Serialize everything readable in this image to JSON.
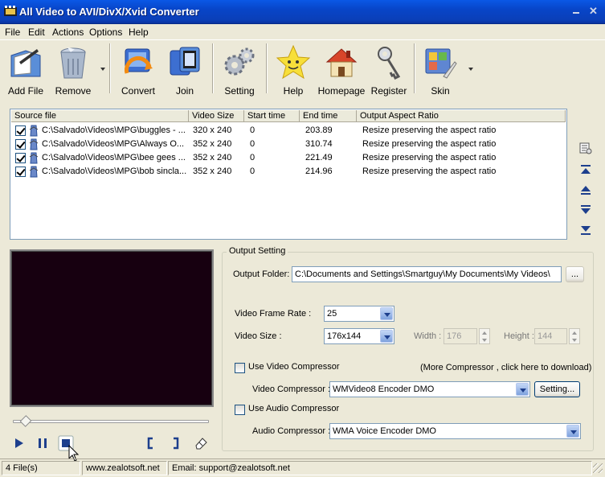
{
  "window": {
    "title": "All Video to AVI/DivX/Xvid Converter"
  },
  "menu": [
    {
      "label": "File"
    },
    {
      "label": "Edit"
    },
    {
      "label": "Actions"
    },
    {
      "label": "Options"
    },
    {
      "label": "Help"
    }
  ],
  "toolbar": [
    {
      "label": "Add File",
      "icon": "add-file-icon"
    },
    {
      "label": "Remove",
      "icon": "recycle-bin-icon"
    },
    {
      "label": "Convert",
      "icon": "convert-icon"
    },
    {
      "label": "Join",
      "icon": "join-icon"
    },
    {
      "label": "Setting",
      "icon": "gears-icon"
    },
    {
      "label": "Help",
      "icon": "star-help-icon"
    },
    {
      "label": "Homepage",
      "icon": "house-icon"
    },
    {
      "label": "Register",
      "icon": "keys-icon"
    },
    {
      "label": "Skin",
      "icon": "skin-icon"
    }
  ],
  "file_list": {
    "columns": [
      "Source file",
      "Video Size",
      "Start time",
      "End time",
      "Output Aspect Ratio"
    ],
    "rows": [
      {
        "source": "C:\\Salvado\\Videos\\MPG\\buggles - ...",
        "size": "320 x 240",
        "start": "0",
        "end": "203.89",
        "aspect": "Resize preserving the aspect ratio",
        "checked": true,
        "selected": true
      },
      {
        "source": "C:\\Salvado\\Videos\\MPG\\Always O...",
        "size": "352 x 240",
        "start": "0",
        "end": "310.74",
        "aspect": "Resize preserving the aspect ratio",
        "checked": true,
        "selected": false
      },
      {
        "source": "C:\\Salvado\\Videos\\MPG\\bee gees ...",
        "size": "352 x 240",
        "start": "0",
        "end": "221.49",
        "aspect": "Resize preserving the aspect ratio",
        "checked": true,
        "selected": false
      },
      {
        "source": "C:\\Salvado\\Videos\\MPG\\bob sincla...",
        "size": "352 x 240",
        "start": "0",
        "end": "214.96",
        "aspect": "Resize preserving the aspect ratio",
        "checked": true,
        "selected": false
      }
    ]
  },
  "output": {
    "group_title": "Output Setting",
    "folder_label": "Output Folder:",
    "folder_value": "C:\\Documents and Settings\\Smartguy\\My Documents\\My Videos\\",
    "browse_label": "...",
    "frame_rate_label": "Video Frame Rate :",
    "frame_rate_value": "25",
    "video_size_label": "Video Size :",
    "video_size_value": "176x144",
    "width_label": "Width :",
    "width_value": "176",
    "height_label": "Height :",
    "height_value": "144",
    "use_video_comp_label": "Use Video Compressor",
    "more_comp_label": "(More Compressor , click here to download)",
    "video_comp_label": "Video Compressor :",
    "video_comp_value": "WMVideo8 Encoder DMO",
    "setting_btn_label": "Setting...",
    "use_audio_comp_label": "Use Audio Compressor",
    "audio_comp_label": "Audio Compressor :",
    "audio_comp_value": "WMA Voice Encoder DMO"
  },
  "player": {
    "position_fraction": 0.05
  },
  "status": {
    "files": "4 File(s)",
    "website": "www.zealotsoft.net",
    "email": "Email: support@zealotsoft.net"
  },
  "colors": {
    "title_bar": "#0a58e6",
    "selection": "#316ac5",
    "preview_bg": "#170010"
  }
}
